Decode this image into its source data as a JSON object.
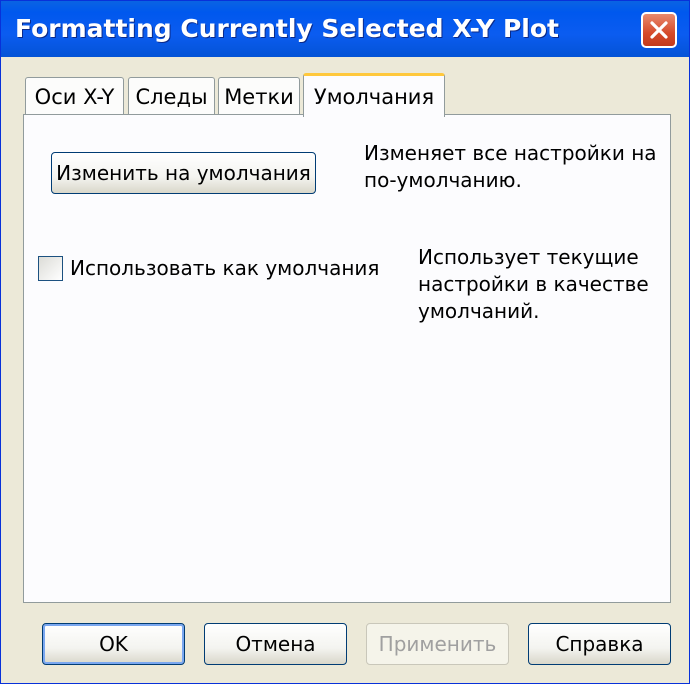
{
  "window": {
    "title": "Formatting Currently Selected X-Y Plot"
  },
  "tabs": [
    {
      "label": "Оси X-Y",
      "active": false
    },
    {
      "label": "Следы",
      "active": false
    },
    {
      "label": "Метки",
      "active": false
    },
    {
      "label": "Умолчания",
      "active": true
    }
  ],
  "defaults_tab": {
    "change_button_label": "Изменить на умолчания",
    "change_description": "Изменяет все настройки на по-умолчанию.",
    "use_checkbox_label": "Использовать как умолчания",
    "use_checkbox_checked": false,
    "use_description": "Использует текущие настройки в качестве умолчаний."
  },
  "footer": {
    "ok_label": "OK",
    "cancel_label": "Отмена",
    "apply_label": "Применить",
    "help_label": "Справка"
  },
  "colors": {
    "titlebar": "#0058ee",
    "window_bg": "#ece9d8",
    "active_tab_accent": "#ffc83c",
    "close_button": "#d64a2a"
  },
  "icons": {
    "close": "close-icon"
  }
}
